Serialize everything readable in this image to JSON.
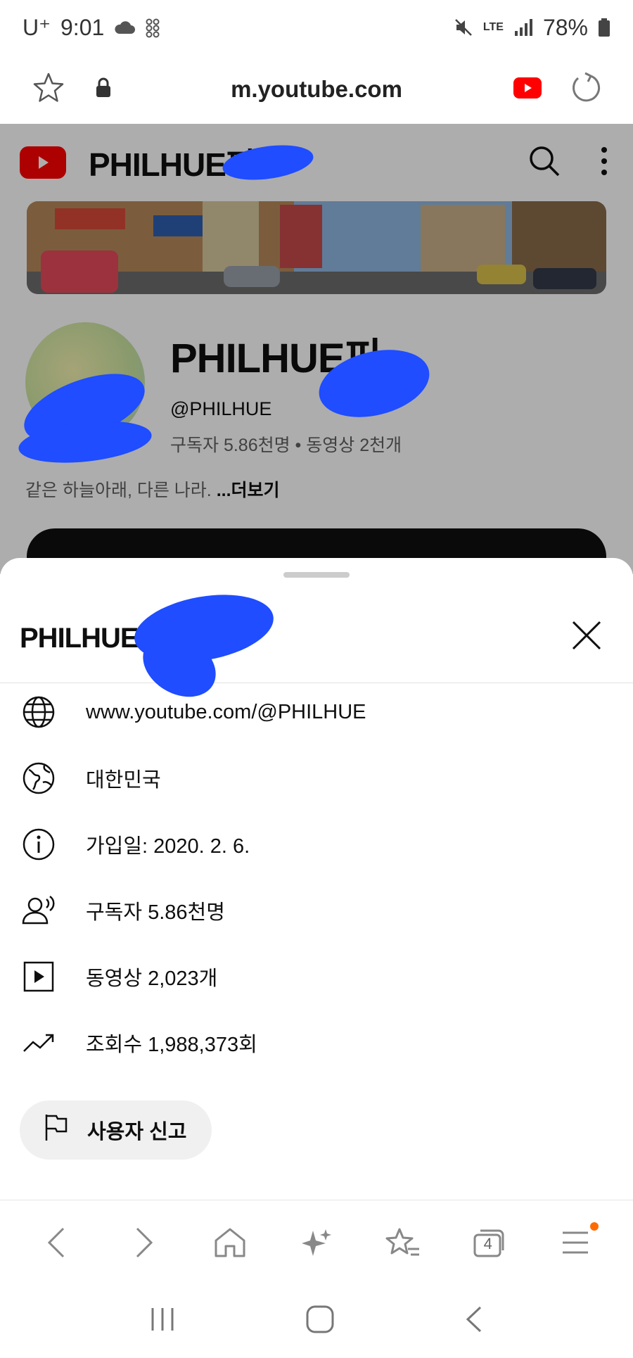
{
  "status_bar": {
    "carrier": "U⁺",
    "time": "9:01",
    "network": "LTE",
    "battery": "78%"
  },
  "browser": {
    "url": "m.youtube.com"
  },
  "page": {
    "header_title": "PHILHUE피",
    "channel_name": "PHILHUE피",
    "handle": "@PHILHUE",
    "stats": "구독자 5.86천명 • 동영상 2천개",
    "description": "같은 하늘아래, 다른 나라. ",
    "more": "...더보기"
  },
  "sheet": {
    "title": "PHILHUE피",
    "items": [
      {
        "icon": "globe-icon",
        "text": "www.youtube.com/@PHILHUE"
      },
      {
        "icon": "earth-icon",
        "text": "대한민국"
      },
      {
        "icon": "info-icon",
        "text": "가입일: 2020. 2. 6."
      },
      {
        "icon": "subscribers-icon",
        "text": "구독자 5.86천명"
      },
      {
        "icon": "video-icon",
        "text": "동영상 2,023개"
      },
      {
        "icon": "trending-icon",
        "text": "조회수 1,988,373회"
      }
    ],
    "report_label": "사용자 신고"
  },
  "browser_nav": {
    "tab_count": "4"
  },
  "colors": {
    "youtube_red": "#ff0000",
    "redaction_blue": "#1f4dff",
    "notification_dot": "#ff6a00"
  }
}
